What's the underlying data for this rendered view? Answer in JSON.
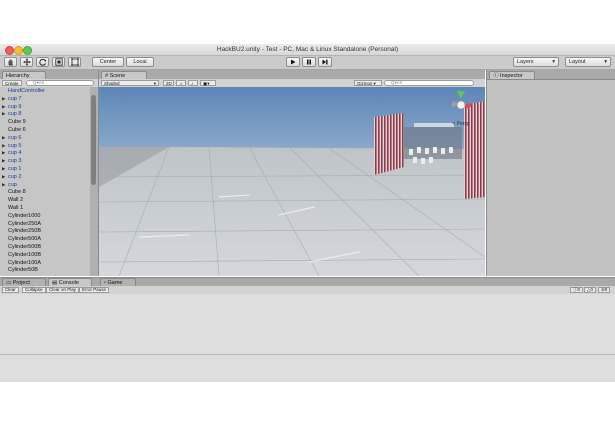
{
  "window": {
    "title": "HackBU2.unity - Test - PC, Mac & Linux Standalone (Personal)"
  },
  "toolbar": {
    "pivot_label": "Center",
    "space_label": "Local",
    "layers_label": "Layers",
    "layout_label": "Layout"
  },
  "hierarchy": {
    "tab_label": "Hierarchy",
    "create_label": "Create ▾",
    "search_placeholder": "Q▾All",
    "items": [
      {
        "label": "HandController",
        "prefab": true,
        "arrow": false
      },
      {
        "label": "cup 7",
        "prefab": true,
        "arrow": true
      },
      {
        "label": "cup 9",
        "prefab": true,
        "arrow": true
      },
      {
        "label": "cup 8",
        "prefab": true,
        "arrow": true
      },
      {
        "label": "Cube 9",
        "prefab": false,
        "arrow": false
      },
      {
        "label": "Cube 6",
        "prefab": false,
        "arrow": false
      },
      {
        "label": "cup 6",
        "prefab": true,
        "arrow": true
      },
      {
        "label": "cup 5",
        "prefab": true,
        "arrow": true
      },
      {
        "label": "cup 4",
        "prefab": true,
        "arrow": true
      },
      {
        "label": "cup 3",
        "prefab": true,
        "arrow": true
      },
      {
        "label": "cup 1",
        "prefab": true,
        "arrow": true
      },
      {
        "label": "cup 2",
        "prefab": true,
        "arrow": true
      },
      {
        "label": "cup",
        "prefab": true,
        "arrow": true
      },
      {
        "label": "Cube 8",
        "prefab": false,
        "arrow": false
      },
      {
        "label": "Wall 2",
        "prefab": false,
        "arrow": false
      },
      {
        "label": "Wall 1",
        "prefab": false,
        "arrow": false
      },
      {
        "label": "Cylinder1000",
        "prefab": false,
        "arrow": false
      },
      {
        "label": "Cylinder250A",
        "prefab": false,
        "arrow": false
      },
      {
        "label": "Cylinder250B",
        "prefab": false,
        "arrow": false
      },
      {
        "label": "Cylinder500A",
        "prefab": false,
        "arrow": false
      },
      {
        "label": "Cylinder500B",
        "prefab": false,
        "arrow": false
      },
      {
        "label": "Cylinder100B",
        "prefab": false,
        "arrow": false
      },
      {
        "label": "Cylinder100A",
        "prefab": false,
        "arrow": false
      },
      {
        "label": "Cylinder50B",
        "prefab": false,
        "arrow": false
      }
    ]
  },
  "scene": {
    "tab_label": "Scene",
    "shading_label": "Shaded",
    "mode_2d_label": "2D",
    "gizmos_label": "Gizmos ▾",
    "search_placeholder": "Q▾All",
    "persp_label": "< Persp"
  },
  "inspector": {
    "tab_label": "Inspector"
  },
  "bottom": {
    "project_tab_label": "Project",
    "console_tab_label": "Console",
    "game_tab_label": "Game",
    "clear_label": "Clear",
    "collapse_label": "Collapse",
    "clear_on_play_label": "Clear on Play",
    "error_pause_label": "Error Pause",
    "log_count": "0",
    "warn_count": "0",
    "error_count": "0"
  }
}
